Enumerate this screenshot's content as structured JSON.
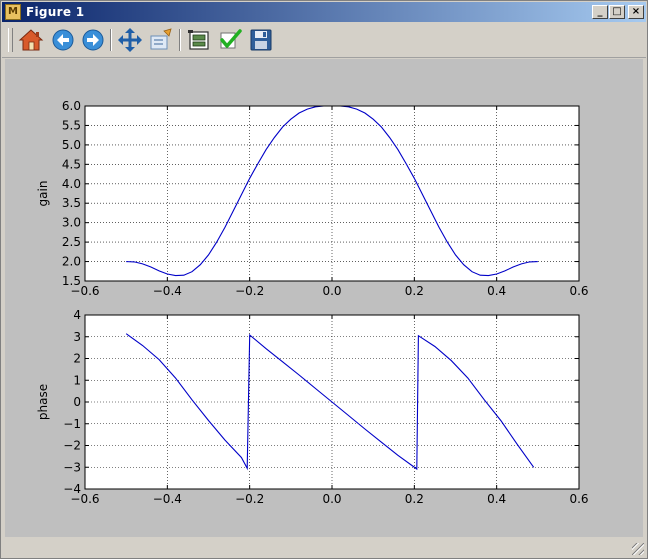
{
  "window": {
    "title": "Figure 1",
    "minimize_label": "_",
    "maximize_label": "□",
    "close_label": "×"
  },
  "toolbar": {
    "buttons": [
      {
        "name": "home-button",
        "icon": "home-icon"
      },
      {
        "name": "back-button",
        "icon": "arrow-left-icon"
      },
      {
        "name": "forward-button",
        "icon": "arrow-right-icon"
      },
      {
        "name": "pan-button",
        "icon": "move-icon"
      },
      {
        "name": "zoom-button",
        "icon": "zoom-rect-icon"
      },
      {
        "name": "subplots-button",
        "icon": "subplots-icon"
      },
      {
        "name": "edit-button",
        "icon": "checkmark-icon"
      },
      {
        "name": "save-button",
        "icon": "floppy-disk-icon"
      }
    ]
  },
  "colors": {
    "line": "#0000c8",
    "figure_bg": "#bfbfbf",
    "axes_bg": "#ffffff"
  },
  "chart_data": [
    {
      "type": "line",
      "ylabel": "gain",
      "xlabel": "",
      "title": "",
      "xlim": [
        -0.6,
        0.6
      ],
      "ylim": [
        1.5,
        6.0
      ],
      "xticks": [
        "−0.6",
        "−0.4",
        "−0.2",
        "0.0",
        "0.2",
        "0.4",
        "0.6"
      ],
      "yticks": [
        "1.5",
        "2.0",
        "2.5",
        "3.0",
        "3.5",
        "4.0",
        "4.5",
        "5.0",
        "5.5",
        "6.0"
      ],
      "grid": true,
      "x": [
        -0.5,
        -0.48,
        -0.46,
        -0.44,
        -0.42,
        -0.4,
        -0.38,
        -0.36,
        -0.34,
        -0.32,
        -0.3,
        -0.28,
        -0.26,
        -0.24,
        -0.22,
        -0.2,
        -0.18,
        -0.16,
        -0.14,
        -0.12,
        -0.1,
        -0.08,
        -0.06,
        -0.04,
        -0.02,
        0.0,
        0.02,
        0.04,
        0.06,
        0.08,
        0.1,
        0.12,
        0.14,
        0.16,
        0.18,
        0.2,
        0.22,
        0.24,
        0.26,
        0.28,
        0.3,
        0.32,
        0.34,
        0.36,
        0.38,
        0.4,
        0.42,
        0.44,
        0.46,
        0.48,
        0.5
      ],
      "y": [
        2.0,
        1.99,
        1.94,
        1.86,
        1.76,
        1.68,
        1.64,
        1.65,
        1.74,
        1.92,
        2.17,
        2.5,
        2.88,
        3.3,
        3.72,
        4.14,
        4.52,
        4.88,
        5.19,
        5.46,
        5.66,
        5.82,
        5.92,
        5.98,
        6.0,
        6.0,
        6.0,
        5.98,
        5.92,
        5.82,
        5.66,
        5.46,
        5.19,
        4.88,
        4.52,
        4.14,
        3.72,
        3.3,
        2.88,
        2.5,
        2.17,
        1.92,
        1.74,
        1.65,
        1.64,
        1.68,
        1.76,
        1.86,
        1.94,
        1.99,
        2.0
      ]
    },
    {
      "type": "line",
      "ylabel": "phase",
      "xlabel": "",
      "title": "",
      "xlim": [
        -0.6,
        0.6
      ],
      "ylim": [
        -4,
        4
      ],
      "xticks": [
        "−0.6",
        "−0.4",
        "−0.2",
        "0.0",
        "0.2",
        "0.4",
        "0.6"
      ],
      "yticks": [
        "−4",
        "−3",
        "−2",
        "−1",
        "0",
        "1",
        "2",
        "3",
        "4"
      ],
      "grid": true,
      "x": [
        -0.5,
        -0.46,
        -0.42,
        -0.38,
        -0.34,
        -0.3,
        -0.26,
        -0.22,
        -0.206,
        -0.2,
        -0.16,
        -0.12,
        -0.08,
        -0.04,
        0.0,
        0.04,
        0.08,
        0.12,
        0.16,
        0.206,
        0.21,
        0.25,
        0.29,
        0.33,
        0.37,
        0.41,
        0.45,
        0.49
      ],
      "y": [
        3.14,
        2.6,
        1.95,
        1.1,
        0.1,
        -0.85,
        -1.75,
        -2.55,
        -3.05,
        3.08,
        2.45,
        1.85,
        1.24,
        0.62,
        0.0,
        -0.62,
        -1.24,
        -1.85,
        -2.45,
        -3.08,
        3.05,
        2.55,
        1.9,
        1.1,
        0.1,
        -0.85,
        -1.95,
        -3.0
      ]
    }
  ]
}
